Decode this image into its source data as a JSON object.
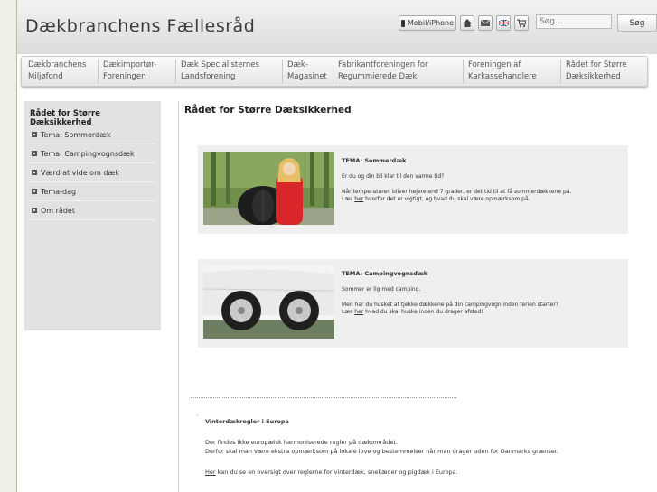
{
  "header": {
    "logo_text": "Dækbranchens Fællesråd",
    "mobile_label": "Mobil/iPhone",
    "search_placeholder": "Søg...",
    "search_button": "Søg",
    "icons": [
      "phone-icon",
      "home-icon",
      "mail-icon",
      "uk-flag-icon",
      "cart-icon"
    ]
  },
  "nav": {
    "items": [
      {
        "line1": "Dækbranchens",
        "line2": "Miljøfond"
      },
      {
        "line1": "Dækimportør-",
        "line2": "Foreningen"
      },
      {
        "line1": "Dæk Specialisternes",
        "line2": "Landsforening"
      },
      {
        "line1": "Dæk-",
        "line2": "Magasinet"
      },
      {
        "line1": "Fabrikantforeningen for",
        "line2": "Regummierede Dæk"
      },
      {
        "line1": "Foreningen af",
        "line2": "Karkassehandlere"
      },
      {
        "line1": "Rådet for Større",
        "line2": "Dæksikkerhed"
      }
    ]
  },
  "sidebar": {
    "title": "Rådet for Større Dæksikkerhed",
    "items": [
      {
        "label": "Tema: Sommerdæk"
      },
      {
        "label": "Tema: Campingvognsdæk"
      },
      {
        "label": "Værd at vide om dæk"
      },
      {
        "label": "Tema-dag"
      },
      {
        "label": "Om rådet"
      }
    ]
  },
  "main": {
    "title": "Rådet for Større Dæksikkerhed",
    "cards": [
      {
        "title": "TEMA: Sommerdæk",
        "p1": "Er du og din bil klar til den varme tid?",
        "p2": "Når temperaturen bliver højere end 7 grader, er det tid til at få sommerdækkene på.",
        "p3_pre": "Læs ",
        "p3_link": "her",
        "p3_post": " hvorfor det er vigtigt, og hvad du skal være opmærksom på."
      },
      {
        "title": "TEMA: Campingvognsdæk",
        "p1": "Sommer er lig med camping.",
        "p2": "Men har du husket at tjekke dækkene på din campingvogn inden ferien starter?",
        "p3_pre": "Læs ",
        "p3_link": "her",
        "p3_post": " hvad du skal huske inden du drager afsted!"
      }
    ],
    "bottom": {
      "tick": "`",
      "heading": "Vinterdækregler i Europa",
      "line1": "Der findes ikke europæisk harmoniserede regler på dækområdet.",
      "line2": "Derfor skal man være ekstra opmærksom på lokale love og bestemmelser når man drager uden for Danmarks grænser.",
      "link": "Her",
      "line3": " kan du se en oversigt over reglerne for vinterdæk, snekæder og pigdæk i Europa."
    }
  }
}
